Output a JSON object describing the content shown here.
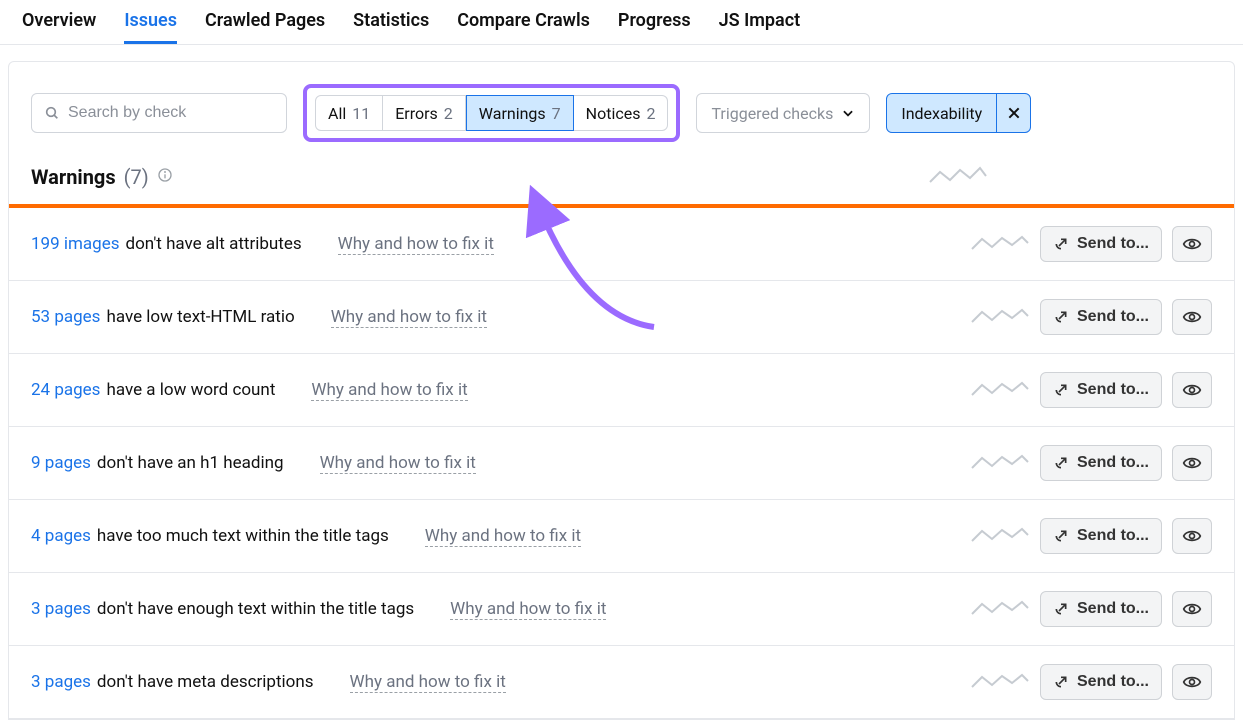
{
  "tabs": {
    "items": [
      "Overview",
      "Issues",
      "Crawled Pages",
      "Statistics",
      "Compare Crawls",
      "Progress",
      "JS Impact"
    ],
    "active_index": 1
  },
  "toolbar": {
    "search_placeholder": "Search by check",
    "segments": [
      {
        "label": "All",
        "count": "11"
      },
      {
        "label": "Errors",
        "count": "2"
      },
      {
        "label": "Warnings",
        "count": "7"
      },
      {
        "label": "Notices",
        "count": "2"
      }
    ],
    "segments_active_index": 2,
    "dropdown_label": "Triggered checks",
    "filter_chip": "Indexability"
  },
  "section": {
    "title": "Warnings",
    "count_display": "(7)"
  },
  "row_action": {
    "send_to": "Send to...",
    "fix_label": "Why and how to fix it"
  },
  "issues": [
    {
      "count_text": "199 images",
      "rest": "don't have alt attributes"
    },
    {
      "count_text": "53 pages",
      "rest": "have low text-HTML ratio"
    },
    {
      "count_text": "24 pages",
      "rest": "have a low word count"
    },
    {
      "count_text": "9 pages",
      "rest": "don't have an h1 heading"
    },
    {
      "count_text": "4 pages",
      "rest": "have too much text within the title tags"
    },
    {
      "count_text": "3 pages",
      "rest": "don't have enough text within the title tags"
    },
    {
      "count_text": "3 pages",
      "rest": "don't have meta descriptions"
    }
  ],
  "annotation": {
    "highlight_color": "#9b6bff"
  }
}
